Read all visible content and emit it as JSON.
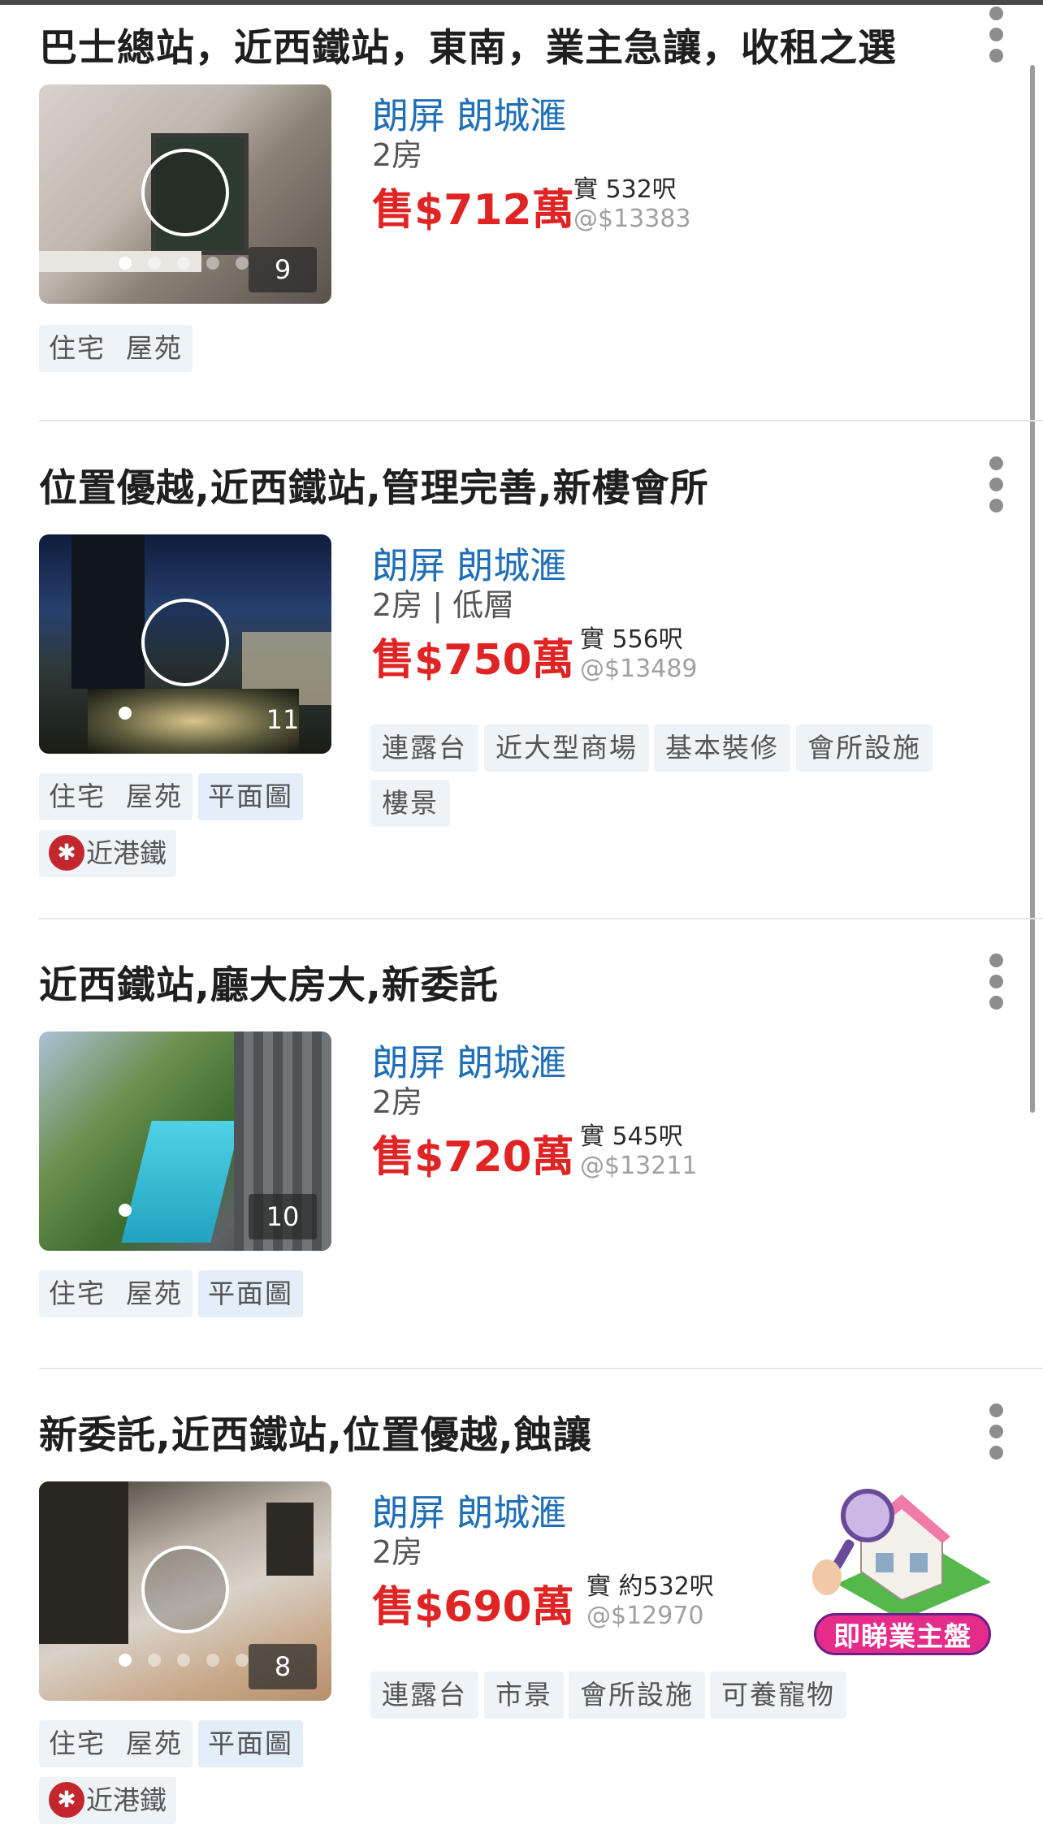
{
  "listings": [
    {
      "title": "巴士總站，近西鐵站，東南，業主急讓，收租之選",
      "estate": "朗屏 朗城滙",
      "rooms": "2房",
      "price": "售$712萬",
      "area": "實 532呎",
      "unit_price": "@$13383",
      "photo_count": "9",
      "tags": [
        "住宅",
        "屋苑"
      ],
      "features": [],
      "near_mtr": ""
    },
    {
      "title": "位置優越,近西鐵站,管理完善,新樓會所",
      "estate": "朗屏 朗城滙",
      "rooms": "2房 | 低層",
      "price": "售$750萬",
      "area": "實 556呎",
      "unit_price": "@$13489",
      "photo_count": "11",
      "tags": [
        "住宅",
        "屋苑",
        "平面圖"
      ],
      "features": [
        "連露台",
        "近大型商場",
        "基本裝修",
        "會所設施",
        "樓景"
      ],
      "near_mtr": "近港鐵"
    },
    {
      "title": "近西鐵站,廳大房大,新委託",
      "estate": "朗屏 朗城滙",
      "rooms": "2房",
      "price": "售$720萬",
      "area": "實 545呎",
      "unit_price": "@$13211",
      "photo_count": "10",
      "tags": [
        "住宅",
        "屋苑",
        "平面圖"
      ],
      "features": [],
      "near_mtr": ""
    },
    {
      "title": "新委託,近西鐵站,位置優越,蝕讓",
      "estate": "朗屏 朗城滙",
      "rooms": "2房",
      "price": "售$690萬",
      "area": "實 約532呎",
      "unit_price": "@$12970",
      "photo_count": "8",
      "tags": [
        "住宅",
        "屋苑",
        "平面圖"
      ],
      "features": [
        "連露台",
        "市景",
        "會所設施",
        "可養寵物"
      ],
      "near_mtr": "近港鐵"
    }
  ],
  "mtr_icon_glyph": "✱",
  "floating_badge": {
    "label": "即睇業主盤",
    "icon": "house-magnifier-icon"
  },
  "colors": {
    "estate": "#1f6fb7",
    "price": "#e02424",
    "tag_bg": "#eef3f8",
    "mtr": "#c4262e",
    "badge": "#e62c8b"
  }
}
